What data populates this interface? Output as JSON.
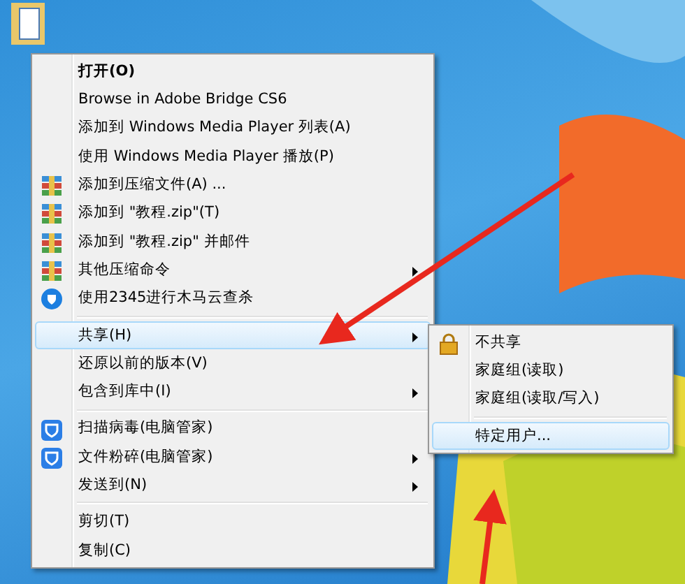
{
  "context_menu": {
    "items": [
      {
        "kind": "plain",
        "label": "打开(O)",
        "default": true,
        "submenu": false,
        "selected": false
      },
      {
        "kind": "plain",
        "label": "Browse in Adobe Bridge CS6",
        "default": false,
        "submenu": false,
        "selected": false
      },
      {
        "kind": "plain",
        "label": "添加到 Windows Media Player 列表(A)",
        "default": false,
        "submenu": false,
        "selected": false
      },
      {
        "kind": "plain",
        "label": "使用 Windows Media Player 播放(P)",
        "default": false,
        "submenu": false,
        "selected": false
      },
      {
        "kind": "archive",
        "label": "添加到压缩文件(A) ...",
        "default": false,
        "submenu": false,
        "selected": false
      },
      {
        "kind": "archive",
        "label": "添加到 \"教程.zip\"(T)",
        "default": false,
        "submenu": false,
        "selected": false
      },
      {
        "kind": "archive",
        "label": "添加到 \"教程.zip\" 并邮件",
        "default": false,
        "submenu": false,
        "selected": false
      },
      {
        "kind": "archive",
        "label": "其他压缩命令",
        "default": false,
        "submenu": true,
        "selected": false
      },
      {
        "kind": "scan",
        "label": "使用2345进行木马云查杀",
        "default": false,
        "submenu": false,
        "selected": false
      },
      {
        "kind": "separator"
      },
      {
        "kind": "plain",
        "label": "共享(H)",
        "default": false,
        "submenu": true,
        "selected": true
      },
      {
        "kind": "plain",
        "label": "还原以前的版本(V)",
        "default": false,
        "submenu": false,
        "selected": false
      },
      {
        "kind": "plain",
        "label": "包含到库中(I)",
        "default": false,
        "submenu": true,
        "selected": false
      },
      {
        "kind": "separator"
      },
      {
        "kind": "guard",
        "label": "扫描病毒(电脑管家)",
        "default": false,
        "submenu": false,
        "selected": false
      },
      {
        "kind": "guard",
        "label": "文件粉碎(电脑管家)",
        "default": false,
        "submenu": true,
        "selected": false
      },
      {
        "kind": "plain",
        "label": "发送到(N)",
        "default": false,
        "submenu": true,
        "selected": false
      },
      {
        "kind": "separator"
      },
      {
        "kind": "plain",
        "label": "剪切(T)",
        "default": false,
        "submenu": false,
        "selected": false
      },
      {
        "kind": "plain",
        "label": "复制(C)",
        "default": false,
        "submenu": false,
        "selected": false
      }
    ]
  },
  "share_submenu": {
    "items": [
      {
        "kind": "lock",
        "label": "不共享",
        "selected": false
      },
      {
        "kind": "plain",
        "label": "家庭组(读取)",
        "selected": false
      },
      {
        "kind": "plain",
        "label": "家庭组(读取/写入)",
        "selected": false
      },
      {
        "kind": "separator"
      },
      {
        "kind": "plain",
        "label": "特定用户...",
        "selected": true
      }
    ]
  }
}
